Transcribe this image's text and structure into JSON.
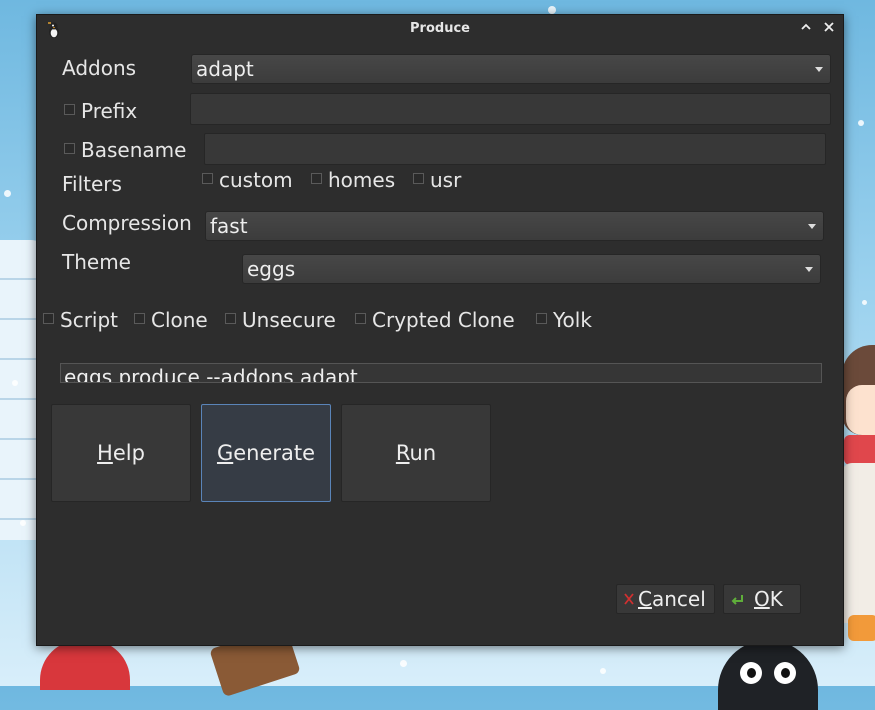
{
  "window": {
    "title": "Produce",
    "minimize_glyph": "⌃",
    "close_glyph": "✕",
    "app_icon": "penguin-icon"
  },
  "form": {
    "addons_label": "Addons",
    "addons_value": "adapt",
    "prefix_label": "Prefix",
    "prefix_value": "",
    "basename_label": "Basename",
    "basename_value": "",
    "filters_label": "Filters",
    "filters": [
      {
        "label": "custom",
        "checked": false
      },
      {
        "label": "homes",
        "checked": false
      },
      {
        "label": "usr",
        "checked": false
      }
    ],
    "compression_label": "Compression",
    "compression_value": "fast",
    "theme_label": "Theme",
    "theme_value": "eggs",
    "options": [
      {
        "label": "Script",
        "checked": false
      },
      {
        "label": "Clone",
        "checked": false
      },
      {
        "label": "Unsecure",
        "checked": false
      },
      {
        "label": "Crypted Clone",
        "checked": false
      },
      {
        "label": "Yolk",
        "checked": false
      }
    ],
    "command_value": "eggs produce --addons adapt"
  },
  "actions": {
    "help_label": "Help",
    "generate_label": "Generate",
    "run_label": "Run"
  },
  "dialog_buttons": {
    "cancel_label": "Cancel",
    "cancel_icon": "red-x-icon",
    "ok_label": "OK",
    "ok_icon": "green-check-icon"
  },
  "colors": {
    "window_bg": "#2d2d2d",
    "focus_border": "#5a84b8",
    "text": "#e6e6e6"
  }
}
